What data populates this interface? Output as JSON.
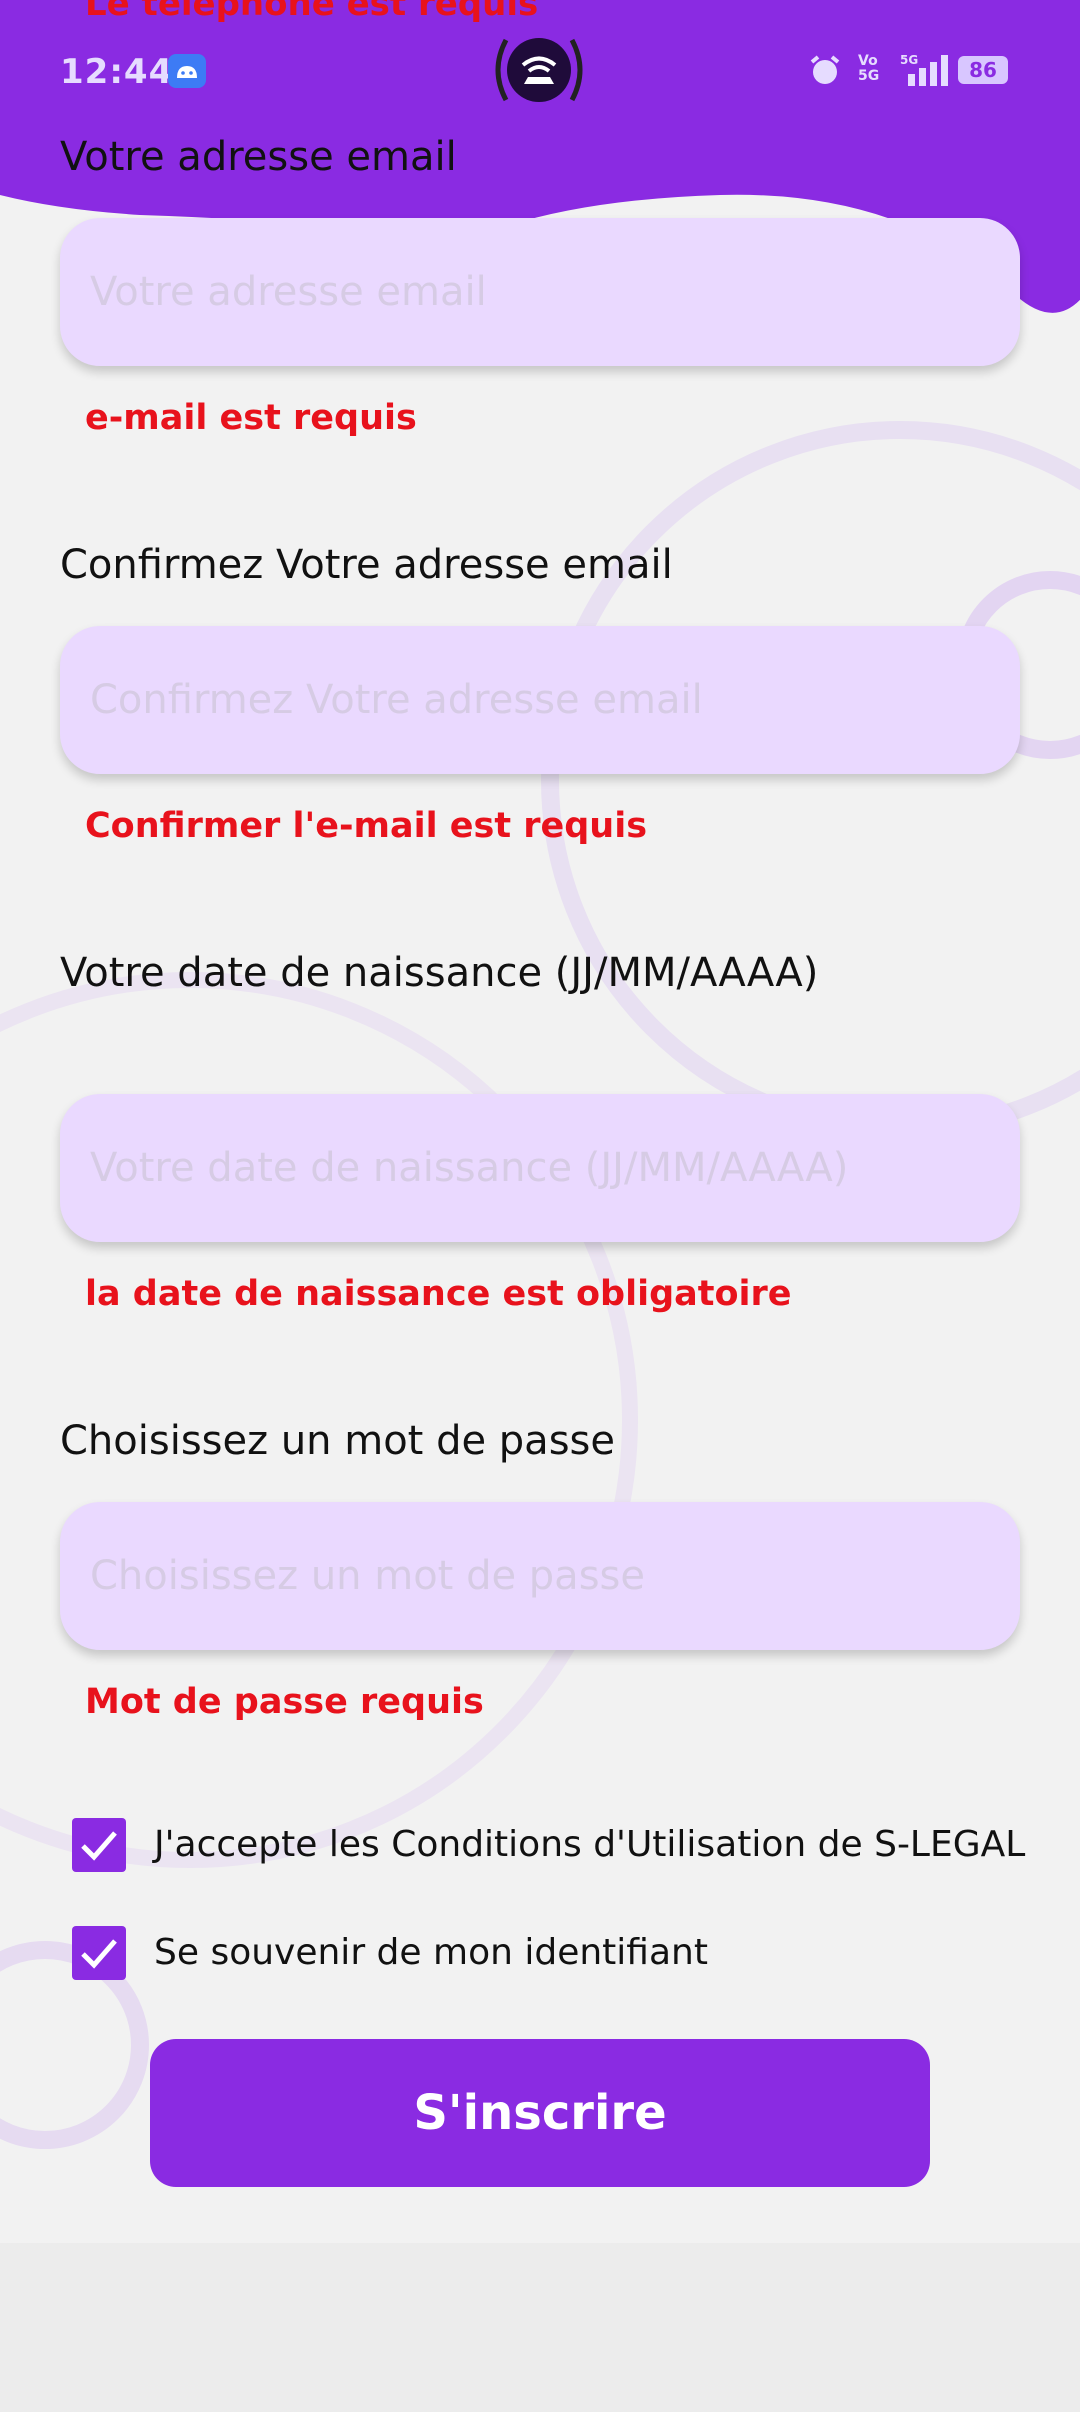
{
  "status_bar": {
    "time": "12:44",
    "battery": "86",
    "volte_line1": "Vo",
    "volte_line2": "5G",
    "network": "5G"
  },
  "top_error": "Le téléphone est requis",
  "fields": [
    {
      "label": "Votre adresse email",
      "placeholder": "Votre adresse email",
      "value": "",
      "error": "e-mail est requis"
    },
    {
      "label": "Confirmez Votre adresse email",
      "placeholder": "Confirmez Votre adresse email",
      "value": "",
      "error": "Confirmer l'e-mail est requis"
    },
    {
      "label": "Votre date de naissance (JJ/MM/AAAA)",
      "placeholder": "Votre date de naissance (JJ/MM/AAAA)",
      "value": "",
      "error": "la date de naissance est obligatoire"
    },
    {
      "label": "Choisissez un mot de passe",
      "placeholder": "Choisissez un mot de passe",
      "value": "",
      "error": "Mot de passe requis"
    }
  ],
  "checkboxes": [
    {
      "label": "J'accepte les Conditions d'Utilisation de S-LEGAL",
      "checked": true
    },
    {
      "label": "Se souvenir de mon identifiant",
      "checked": true
    }
  ],
  "submit_label": "S'inscrire",
  "colors": {
    "accent": "#8a2be2",
    "input_bg": "#ead9ff",
    "error": "#e8121c",
    "background": "#f2f2f2"
  },
  "icons": [
    "android-icon",
    "hotspot-icon",
    "alarm-icon",
    "signal-icon",
    "battery-icon",
    "checkmark-icon"
  ]
}
